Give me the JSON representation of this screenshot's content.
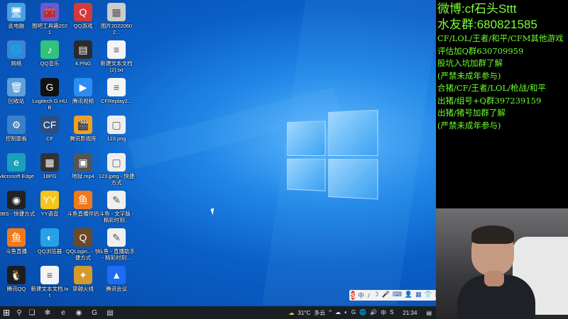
{
  "desktop": {
    "icons": [
      {
        "label": "此电脑",
        "color": "#4a9fe0",
        "glyph": "🖥"
      },
      {
        "label": "网络",
        "color": "#3a86d0",
        "glyph": "🌐"
      },
      {
        "label": "回收站",
        "color": "#5fa0d8",
        "glyph": "🗑"
      },
      {
        "label": "控制面板",
        "color": "#3b7fc8",
        "glyph": "⚙"
      },
      {
        "label": "Microsoft Edge",
        "color": "#1aa0b8",
        "glyph": "e"
      },
      {
        "label": "OBS - 快捷方式",
        "color": "#222",
        "glyph": "◉"
      },
      {
        "label": "斗鱼直播",
        "color": "#f07a1a",
        "glyph": "鱼"
      },
      {
        "label": "腾讯QQ",
        "color": "#1d1d1d",
        "glyph": "🐧"
      },
      {
        "label": "图吧工具箱2021",
        "color": "#6a5acd",
        "glyph": "🧰"
      },
      {
        "label": "QQ音乐",
        "color": "#31c27c",
        "glyph": "♪"
      },
      {
        "label": "Logitech G HUB",
        "color": "#111",
        "glyph": "G"
      },
      {
        "label": "CF",
        "color": "#2a4e80",
        "glyph": "CF"
      },
      {
        "label": "18PG",
        "color": "#333",
        "glyph": "▦"
      },
      {
        "label": "YY语音",
        "color": "#f5c518",
        "glyph": "YY"
      },
      {
        "label": "QQ浏览器",
        "color": "#27a0e6",
        "glyph": "◐"
      },
      {
        "label": "新建文本文档.txt",
        "color": "#f4f4f4",
        "glyph": "≡"
      },
      {
        "label": "QQ游戏",
        "color": "#d43a3a",
        "glyph": "Q"
      },
      {
        "label": "4.PNG",
        "color": "#2b2b2b",
        "glyph": "▤"
      },
      {
        "label": "腾讯视频",
        "color": "#2b8cf2",
        "glyph": "▶"
      },
      {
        "label": "腾讯影视库",
        "color": "#f0a020",
        "glyph": "🎬"
      },
      {
        "label": "地狱.mp4",
        "color": "#555",
        "glyph": "▣"
      },
      {
        "label": "斗鱼直播伴侣",
        "color": "#f07a1a",
        "glyph": "鱼"
      },
      {
        "label": "QQLogin...- 快捷方式",
        "color": "#6b4a2a",
        "glyph": "Q"
      },
      {
        "label": "穿越火线",
        "color": "#d49a2a",
        "glyph": "✦"
      },
      {
        "label": "图片20220602...",
        "color": "#ccc",
        "glyph": "▦"
      },
      {
        "label": "新建文本文档(2).txt",
        "color": "#f4f4f4",
        "glyph": "≡"
      },
      {
        "label": "CFReplay2...",
        "color": "#f4f4f4",
        "glyph": "≡"
      },
      {
        "label": "123.png",
        "color": "#eee",
        "glyph": "▢"
      },
      {
        "label": "123.jpeg - 快捷方式",
        "color": "#eee",
        "glyph": "▢"
      },
      {
        "label": "斗鱼 - 文字版 - 精彩时刻...",
        "color": "#f0f0f0",
        "glyph": "✎"
      },
      {
        "label": "斗鱼 - 直播助手 - 精彩时刻...",
        "color": "#f0f0f0",
        "glyph": "✎"
      },
      {
        "label": "腾讯会议",
        "color": "#1d6cf2",
        "glyph": "▲"
      }
    ]
  },
  "ime_bar": {
    "logo": "S",
    "items": [
      "中",
      "ﾉ",
      "☽",
      "🎤",
      "⌨",
      "👤",
      "▦",
      "👕",
      "▦"
    ]
  },
  "taskbar": {
    "start": "⊞",
    "search": "⚲",
    "task": "❏",
    "apps": [
      "✻",
      "e",
      "◉",
      "G",
      "▤"
    ],
    "weather": "31°C",
    "weather_text": "多云",
    "tray_icons": [
      "^",
      "☁",
      "◐",
      "G",
      "🌐",
      "🔊",
      "中",
      "S"
    ],
    "time": "21:34",
    "notify": "▤"
  },
  "overlay": {
    "lines_big": [
      "微博:cf石头Sttt",
      "水友群:680821585"
    ],
    "lines_small": [
      "CF/LOL/王者/和平/CFM其他游戏",
      "评估加Q群630709959",
      "股坑入坑加群了解",
      "(严禁未成年参与)",
      "合猪/CF/王者/LOL/枪战/和平",
      "出猪/组号+Q群397239159",
      "出猪/猪号加群了解",
      "(严禁未成年参与)"
    ]
  }
}
